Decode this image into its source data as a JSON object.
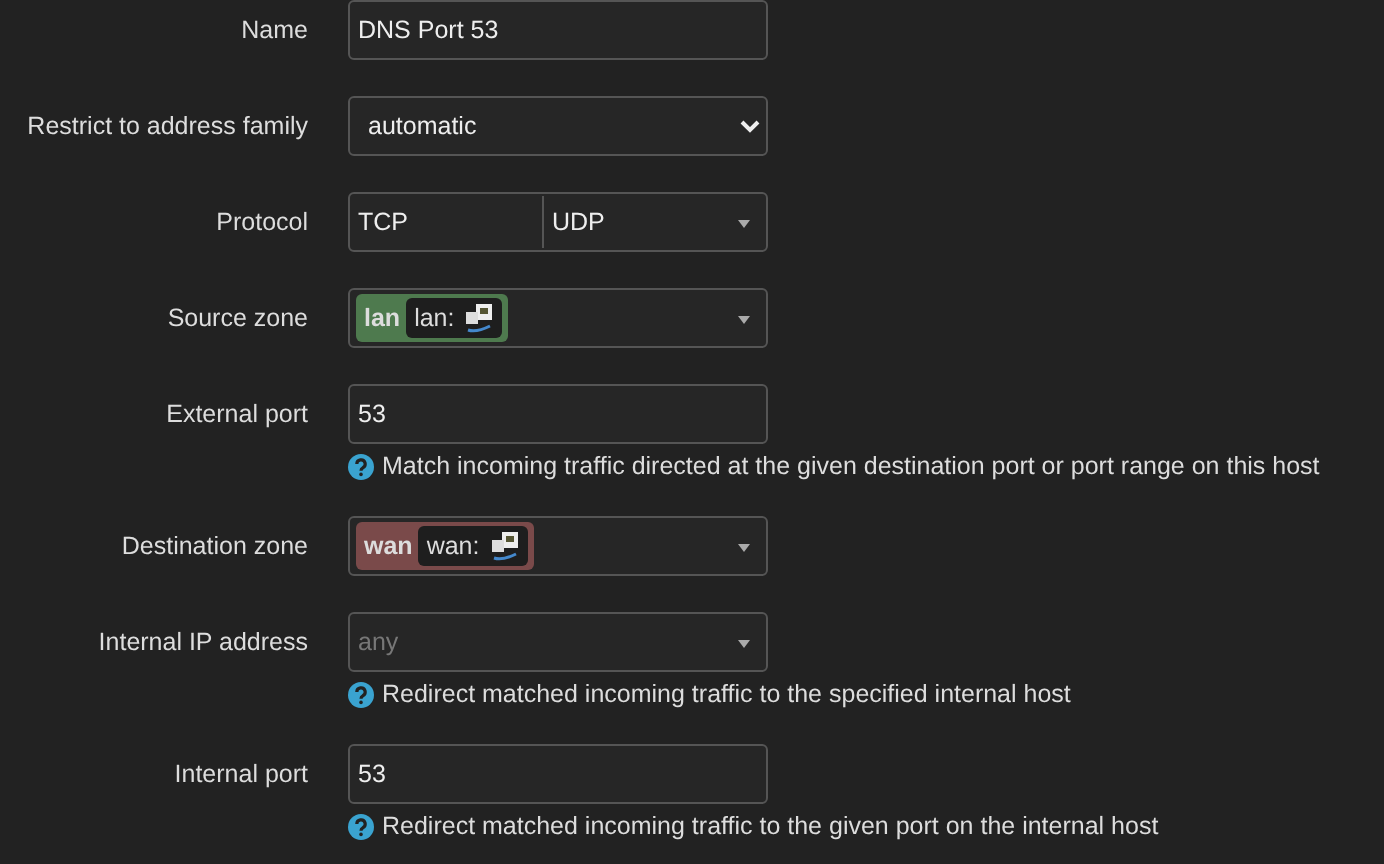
{
  "fields": [
    {
      "label": "Name",
      "kind": "text",
      "value": "DNS Port 53"
    },
    {
      "label": "Restrict to address family",
      "kind": "select",
      "value": "automatic"
    },
    {
      "label": "Protocol",
      "kind": "multi",
      "values": [
        "TCP",
        "UDP"
      ]
    },
    {
      "label": "Source zone",
      "kind": "zone",
      "zone": "lan",
      "network": "lan:",
      "color": "#4e7a4e"
    },
    {
      "label": "External port",
      "kind": "text",
      "value": "53",
      "hint": "Match incoming traffic directed at the given destination port or port range on this host"
    },
    {
      "label": "Destination zone",
      "kind": "zone",
      "zone": "wan",
      "network": "wan:",
      "color": "#7a4a4a"
    },
    {
      "label": "Internal IP address",
      "kind": "dropdown",
      "placeholder": "any",
      "hint": "Redirect matched incoming traffic to the specified internal host"
    },
    {
      "label": "Internal port",
      "kind": "text",
      "value": "53",
      "hint": "Redirect matched incoming traffic to the given port on the internal host"
    }
  ]
}
